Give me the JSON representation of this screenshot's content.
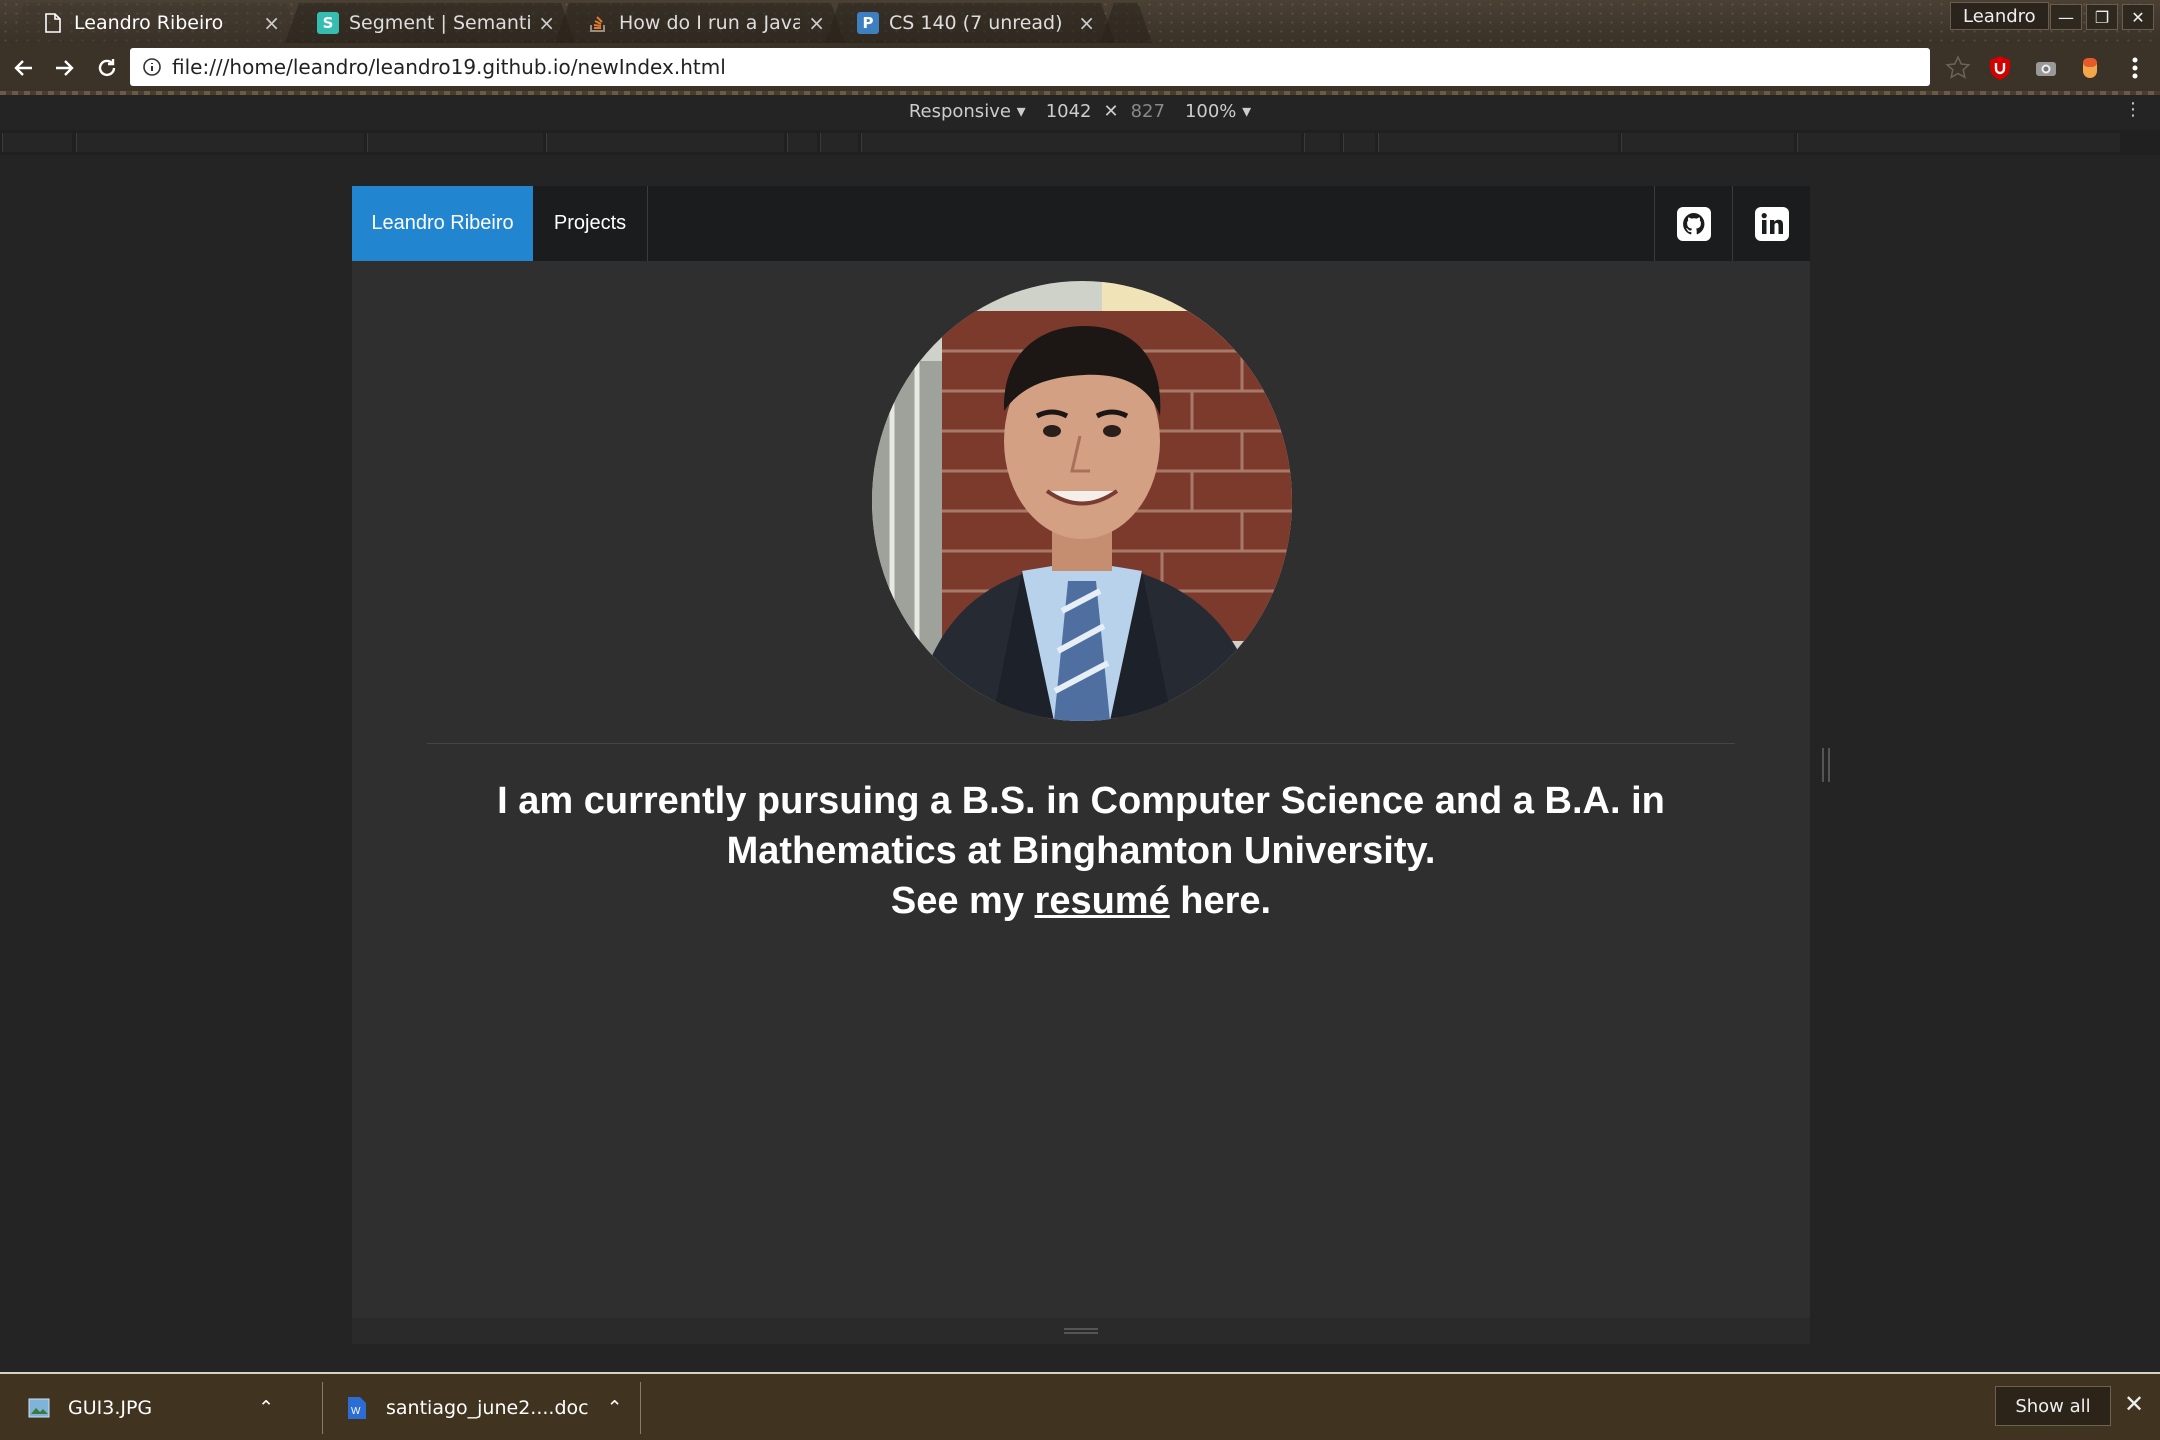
{
  "browser": {
    "tabs": [
      {
        "label": "Leandro Ribeiro",
        "icon": "page-icon"
      },
      {
        "label": "Segment | Semantic UI",
        "icon": "semantic-s-icon"
      },
      {
        "label": "How do I run a Java pr",
        "icon": "stackoverflow-icon"
      },
      {
        "label": "CS 140 (7 unread)",
        "icon": "piazza-p-icon"
      }
    ],
    "profile_name": "Leandro",
    "url": "file:///home/leandro/leandro19.github.io/newIndex.html"
  },
  "devtools": {
    "device": "Responsive",
    "width": "1042",
    "height": "827",
    "zoom": "100%"
  },
  "site": {
    "brand": "Leandro Ribeiro",
    "nav_projects": "Projects",
    "bio_line1": "I am currently pursuing a B.S. in Computer Science and a B.A. in",
    "bio_line2": "Mathematics at Binghamton University.",
    "bio_see": "See my ",
    "bio_link": "resumé",
    "bio_after": " here."
  },
  "downloads": {
    "items": [
      {
        "name": "GUI3.JPG",
        "icon": "image-file-icon"
      },
      {
        "name": "santiago_june2....doc",
        "icon": "word-doc-icon"
      }
    ],
    "show_all": "Show all"
  },
  "colors": {
    "accent": "#2185d0",
    "nav_bg": "#1b1c1d",
    "page_bg": "#2f2f2f"
  }
}
